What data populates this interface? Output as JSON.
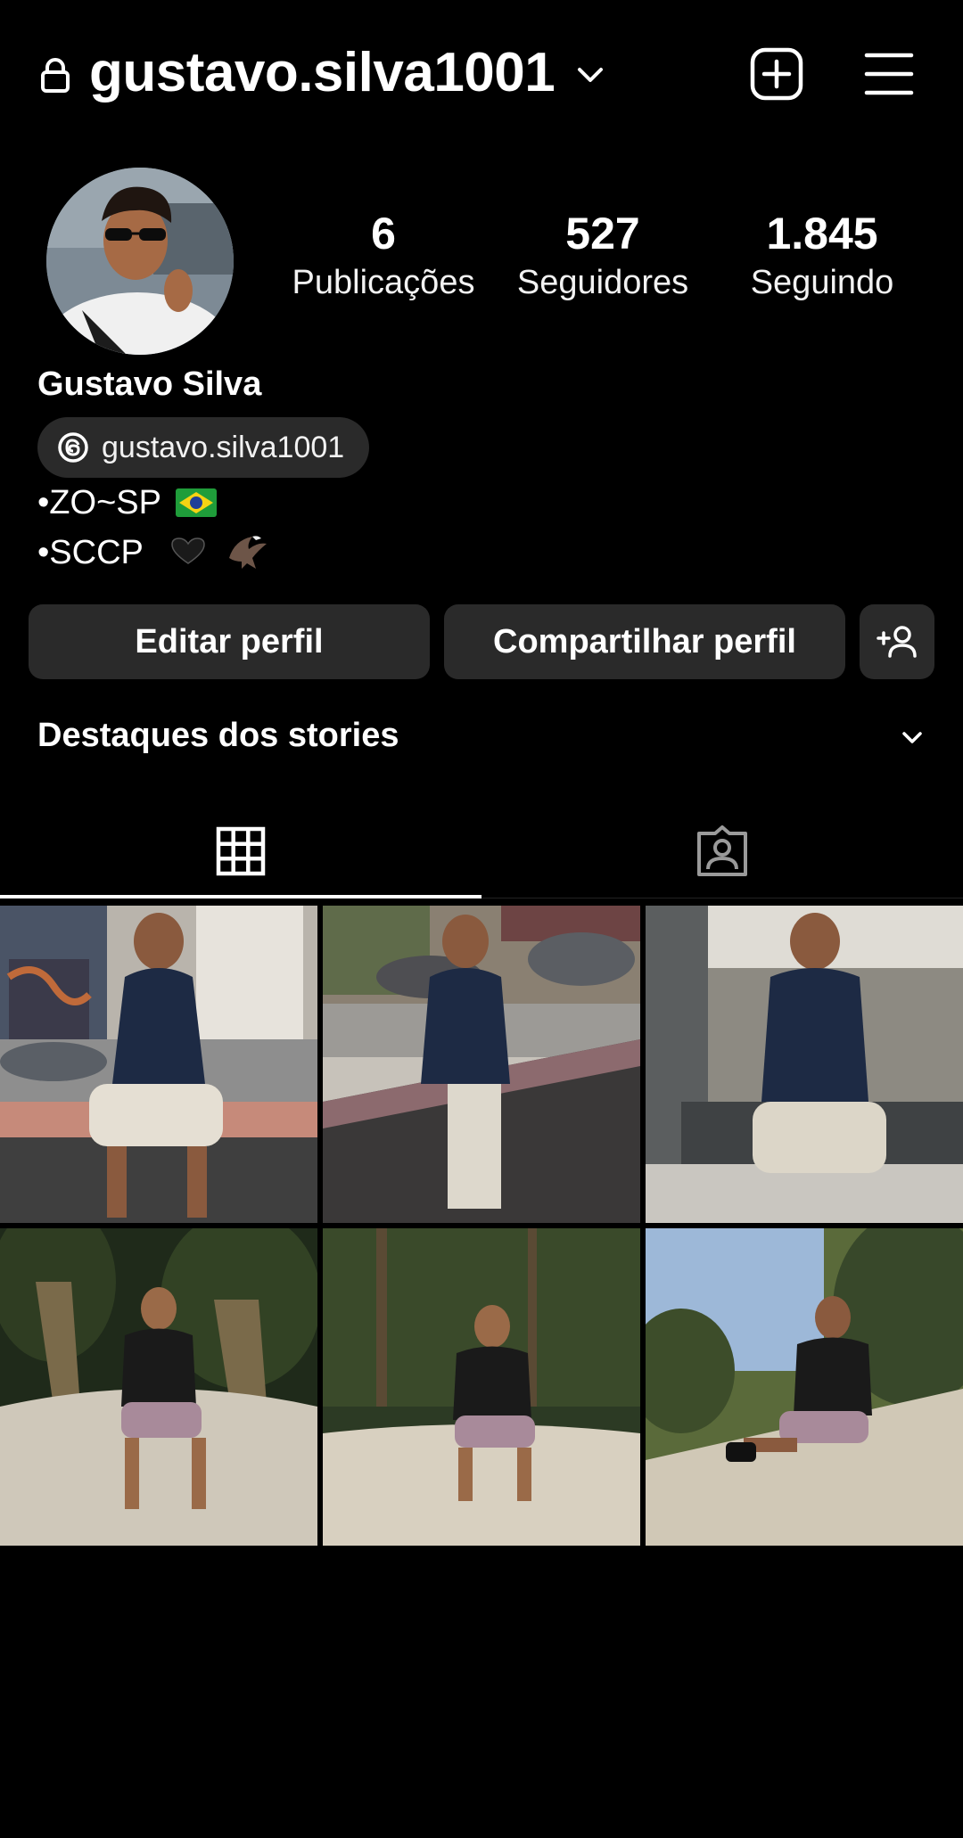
{
  "header": {
    "username": "gustavo.silva1001",
    "icons": {
      "lock": "lock-icon",
      "dropdown": "chevron-down-icon",
      "create": "plus-square-icon",
      "menu": "hamburger-menu-icon"
    }
  },
  "profile": {
    "avatar": "profile-photo",
    "full_name": "Gustavo Silva",
    "threads_handle": "gustavo.silva1001",
    "stats": [
      {
        "value": "6",
        "label": "Publicações"
      },
      {
        "value": "527",
        "label": "Seguidores"
      },
      {
        "value": "1.845",
        "label": "Seguindo"
      }
    ],
    "bio": [
      "•ZO~SP",
      "•SCCP"
    ]
  },
  "buttons": {
    "edit": "Editar perfil",
    "share": "Compartilhar perfil",
    "add_user_icon": "person-add-icon"
  },
  "highlights": {
    "title": "Destaques dos stories"
  },
  "tabs": [
    {
      "icon": "grid-icon",
      "active": true
    },
    {
      "icon": "tagged-person-icon",
      "active": false
    }
  ],
  "posts_count_shown": 6,
  "colors": {
    "background": "#000000",
    "surface": "#2a2a2a",
    "text": "#ffffff"
  }
}
